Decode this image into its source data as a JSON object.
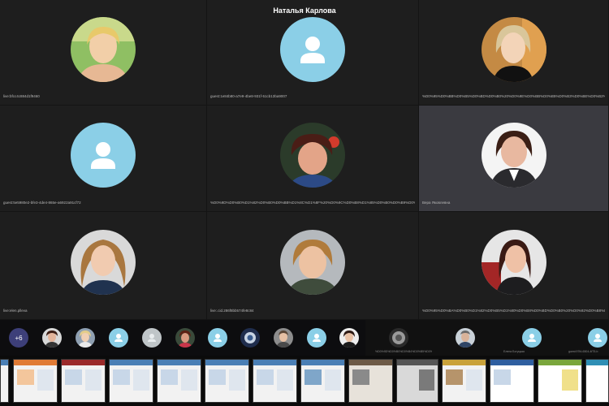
{
  "meeting": {
    "presenter_name": "Наталья Карлова"
  },
  "participants": [
    {
      "label": "live:bfcc4c884d1f9460",
      "avatar": "photo"
    },
    {
      "label": "guest:1e84b80-a7e9-4be8-931f-51cb13ba9007",
      "avatar": "placeholder"
    },
    {
      "label": "%D0%95%D0%BB%D0%B5%D0%BD%D0%B0%20%D0%9E%D0%BB%D0%B5%D0%B3%D0%BE%D0%B2%D0%BD%D0%B0",
      "avatar": "photo"
    },
    {
      "label": "guest:5e5980e2-bfe3-4de4-865e-a6922a91cf72",
      "avatar": "placeholder"
    },
    {
      "label": "%D0%9D%D0%B0%D1%82%D0%B0%D0%BB%D1%8C%D1%8F%20%D0%9C%D0%B8%D1%85%D0%B0%D0%B9%D0%BB%D0%BE%D0%B2%D0%BD%D0%B0",
      "avatar": "photo"
    },
    {
      "label": "Вера Яковлевна",
      "avatar": "photo",
      "active": true
    },
    {
      "label": "live:elen.plleva",
      "avatar": "photo"
    },
    {
      "label": "live:.cid.286f8bb574fe8c84",
      "avatar": "photo"
    },
    {
      "label": "%D0%95%D0%BA%D0%B0%D1%82%D0%B5%D1%80%D0%B8%D0%BD%D0%B0%20%D0%92%D0%B8%D0%BA%D1%82%D0%BE%D1%80%D0%BE%D0%B2%D0%BD%D0%B0",
      "avatar": "photo"
    }
  ],
  "strip": {
    "more_count": "+6",
    "labels": [
      "%D0%9D%D0%B0%D0%B4%D0%B5%D0%B6%D0%B4%D0%B0",
      "Елена Богуцкая",
      "guest:97fd-6504-4f75-b"
    ]
  },
  "colors": {
    "placeholder": "#8bcfe7",
    "active_tile": "#3a3a40",
    "overflow_chip": "#3d3f79"
  }
}
